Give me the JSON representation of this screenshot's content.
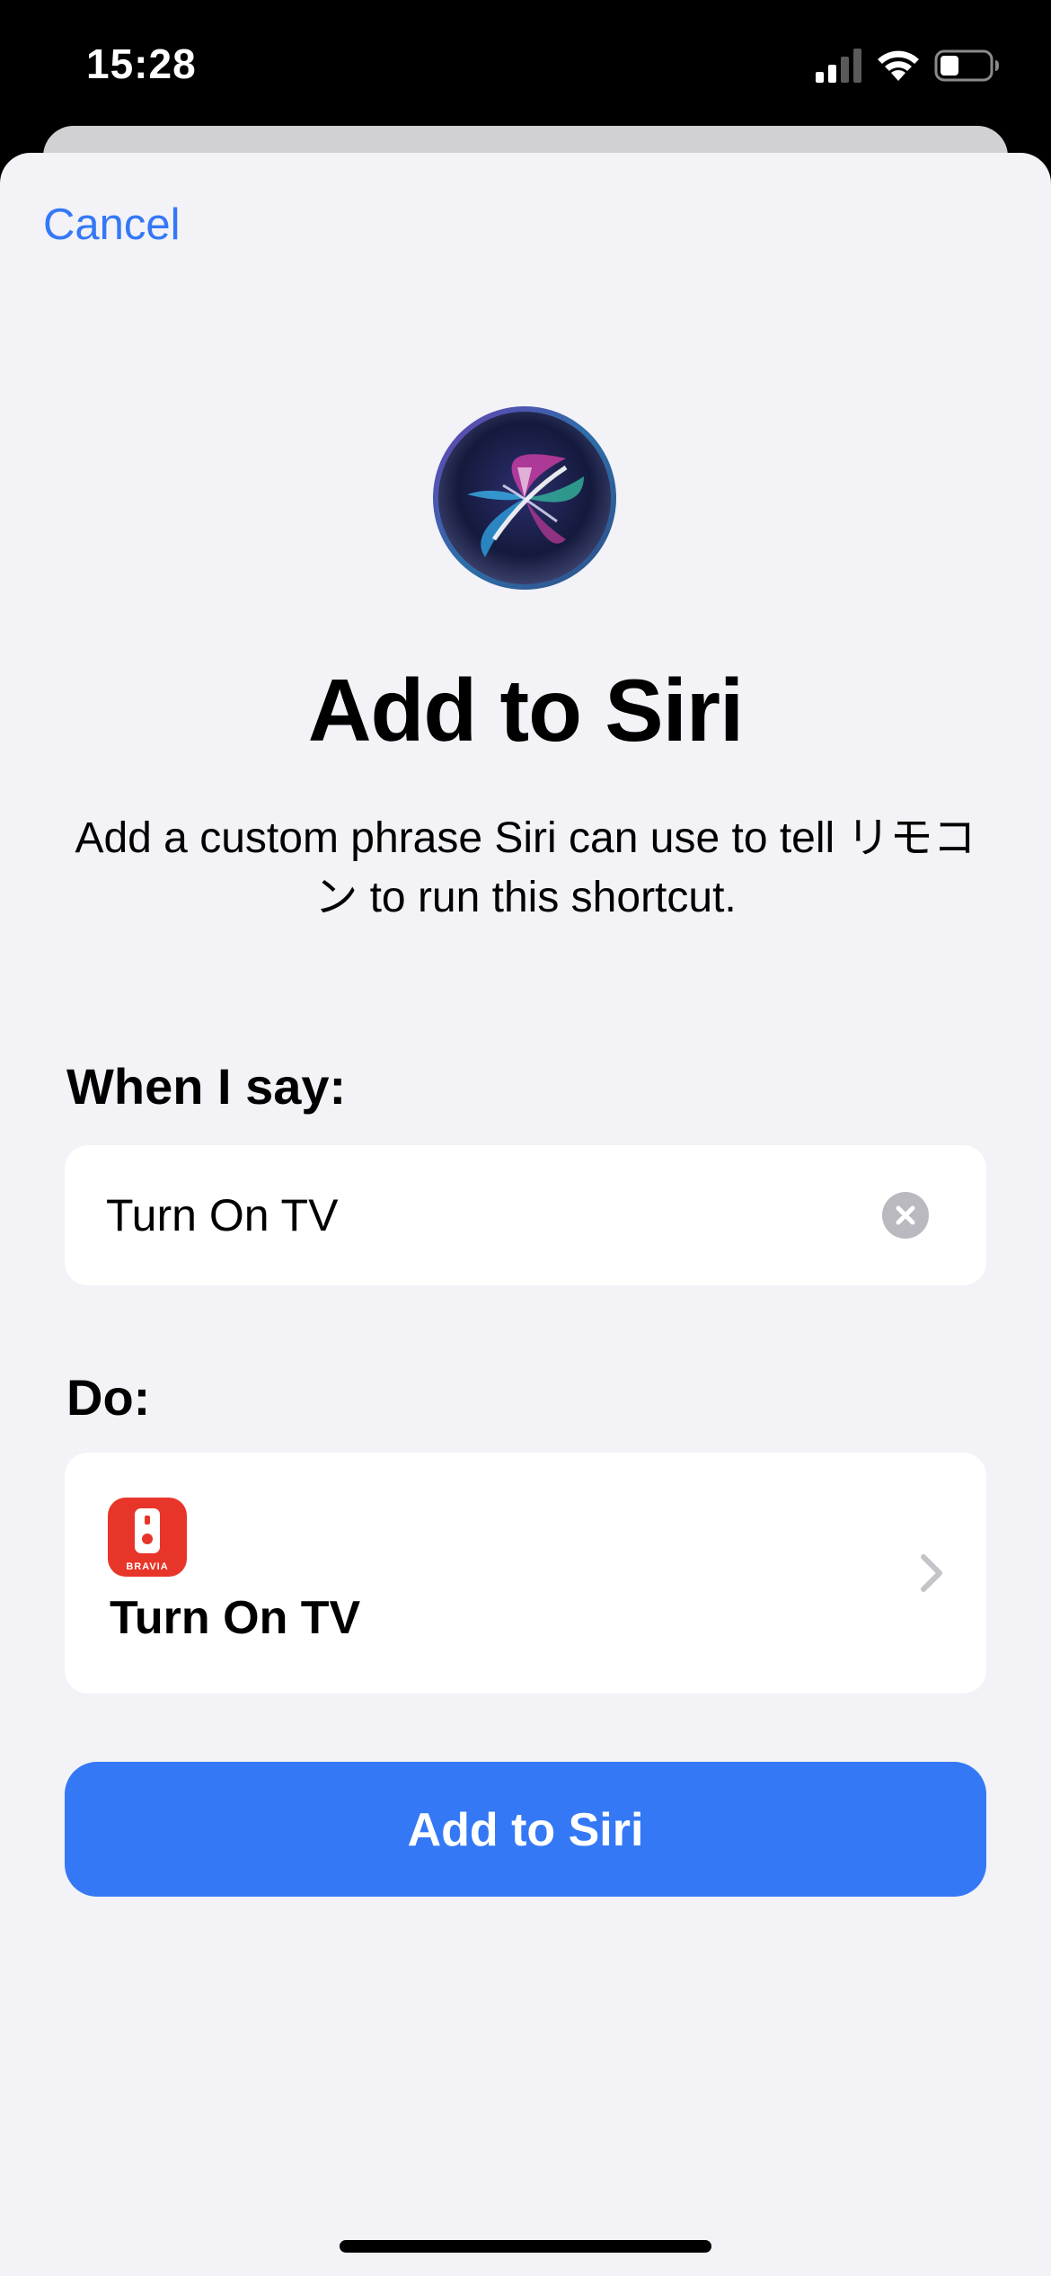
{
  "status_bar": {
    "time": "15:28",
    "signal_icon": "cellular-signal-icon",
    "wifi_icon": "wifi-icon",
    "battery_icon": "battery-icon"
  },
  "sheet": {
    "cancel_label": "Cancel",
    "siri_icon": "siri-orb-icon",
    "title": "Add to Siri",
    "subtitle": "Add a custom phrase Siri can use to tell リモコン to run this shortcut."
  },
  "phrase_section": {
    "label": "When I say:",
    "input_value": "Turn On TV",
    "clear_icon": "clear-circle-icon"
  },
  "action_section": {
    "label": "Do:",
    "app_icon": "bravia-app-icon",
    "app_icon_text": "BRAVIA",
    "action_title": "Turn On TV",
    "chevron_icon": "chevron-right-icon"
  },
  "primary_button": {
    "label": "Add to Siri"
  },
  "colors": {
    "accent": "#3478f6",
    "sheet_background": "#f2f2f7",
    "card_background": "#ffffff",
    "app_icon_red": "#e8352a"
  }
}
